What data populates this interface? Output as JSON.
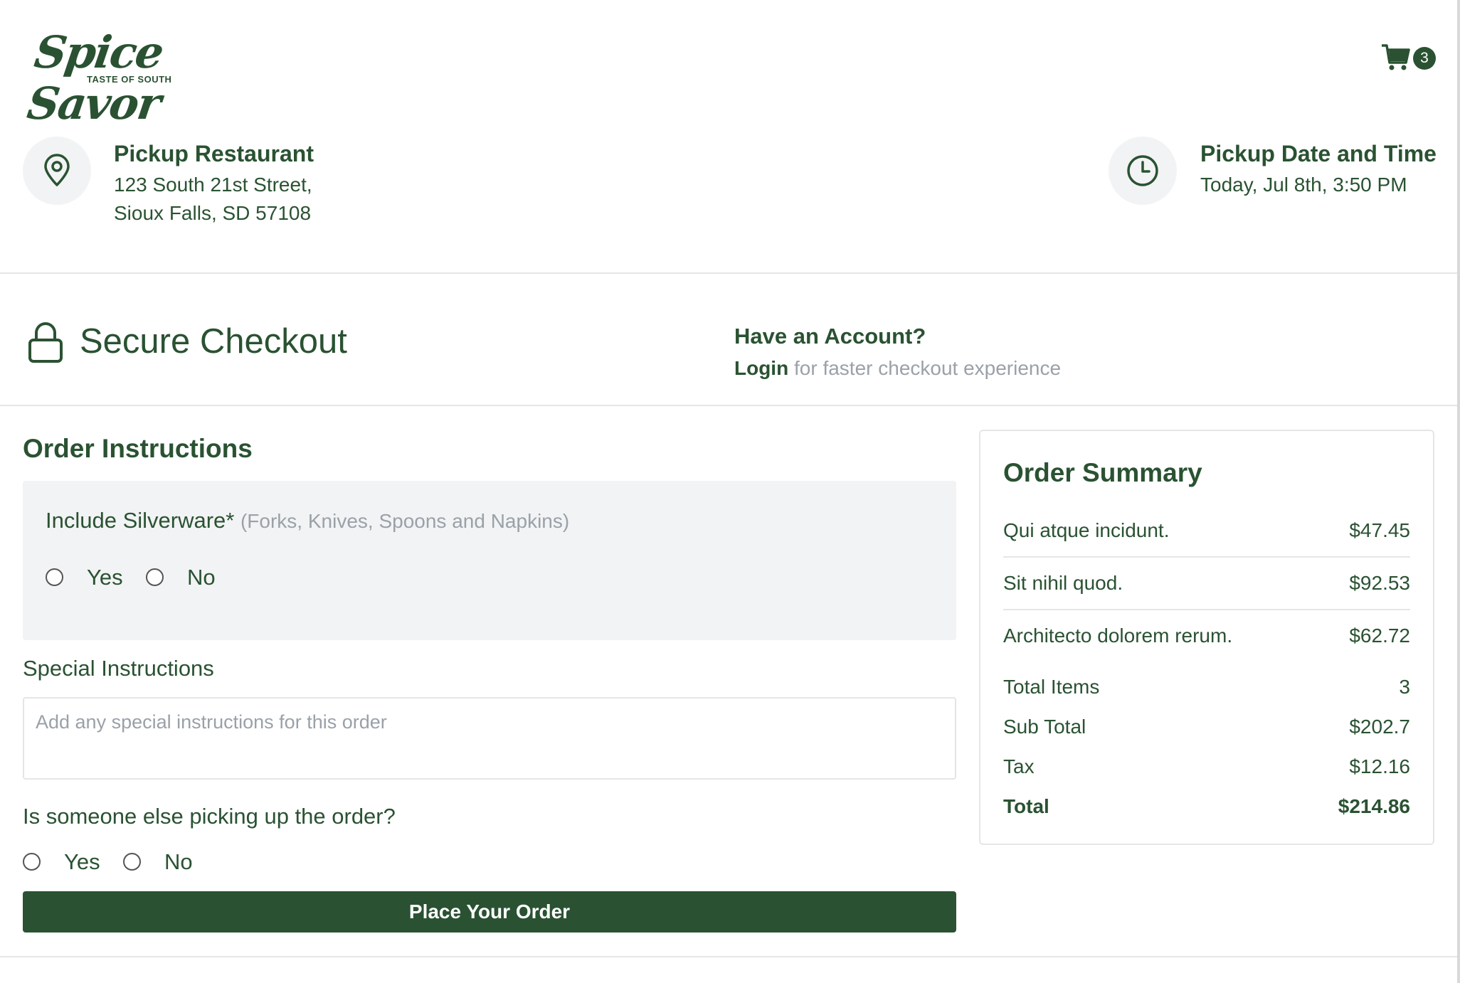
{
  "brand": {
    "name": "Spice Savor",
    "tagline": "TASTE OF SOUTH",
    "color": "#2a5232"
  },
  "cart": {
    "icon": "cart-icon",
    "count": "3"
  },
  "pickup_restaurant": {
    "icon": "location-pin-icon",
    "title": "Pickup Restaurant",
    "address_line1": "123 South 21st Street,",
    "address_line2": "Sioux Falls, SD 57108"
  },
  "pickup_time": {
    "icon": "clock-icon",
    "title": "Pickup Date and Time",
    "value": "Today, Jul 8th, 3:50 PM"
  },
  "checkout": {
    "icon": "lock-icon",
    "title": "Secure Checkout",
    "account_title": "Have an Account?",
    "login_label": "Login",
    "login_suffix": " for faster checkout experience"
  },
  "order_instructions": {
    "title": "Order Instructions",
    "silverware": {
      "label": "Include Silverware*",
      "hint": "(Forks, Knives, Spoons and Napkins)",
      "yes": "Yes",
      "no": "No"
    },
    "special": {
      "label": "Special Instructions",
      "placeholder": "Add any special instructions for this order",
      "value": ""
    },
    "someone_else": {
      "label": "Is someone else picking up the order?",
      "yes": "Yes",
      "no": "No"
    },
    "place_order_label": "Place Your Order"
  },
  "summary": {
    "title": "Order Summary",
    "items": [
      {
        "name": "Qui atque incidunt.",
        "price": "$47.45"
      },
      {
        "name": "Sit nihil quod.",
        "price": "$92.53"
      },
      {
        "name": "Architecto dolorem rerum.",
        "price": "$62.72"
      }
    ],
    "total_items_label": "Total Items",
    "total_items": "3",
    "subtotal_label": "Sub Total",
    "subtotal": "$202.7",
    "tax_label": "Tax",
    "tax": "$12.16",
    "total_label": "Total",
    "total": "$214.86"
  }
}
